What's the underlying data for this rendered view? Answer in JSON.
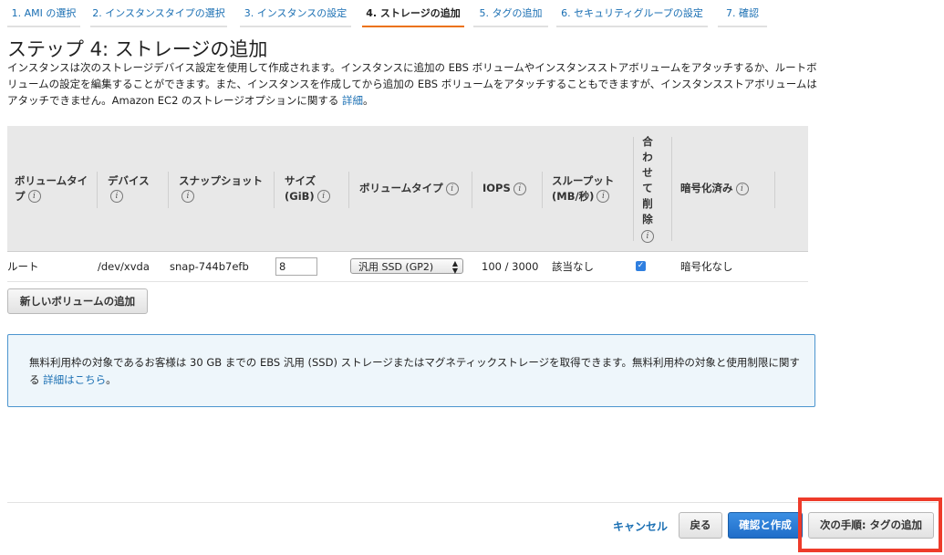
{
  "steps": [
    {
      "label": "1. AMI の選択"
    },
    {
      "label": "2. インスタンスタイプの選択"
    },
    {
      "label": "3. インスタンスの設定"
    },
    {
      "label": "4. ストレージの追加"
    },
    {
      "label": "5. タグの追加"
    },
    {
      "label": "6. セキュリティグループの設定"
    },
    {
      "label": "7. 確認"
    }
  ],
  "header": {
    "title": "ステップ 4: ストレージの追加",
    "description": "インスタンスは次のストレージデバイス設定を使用して作成されます。インスタンスに追加の EBS ボリュームやインスタンスストアボリュームをアタッチするか、ルートボリュームの設定を編集することができます。また、インスタンスを作成してから追加の EBS ボリュームをアタッチすることもできますが、インスタンスストアボリュームはアタッチできません。Amazon EC2 のストレージオプションに関する ",
    "details_link": "詳細",
    "description_end": "。"
  },
  "table": {
    "columns": {
      "volume_type": "ボリュームタイプ",
      "device": "デバイス",
      "snapshot": "スナップショット",
      "size": "サイズ (GiB)",
      "volume_kind": "ボリュームタイプ",
      "iops": "IOPS",
      "throughput": "スループット (MB/秒)",
      "delete": "合わせて削除",
      "encrypted": "暗号化済み"
    },
    "info_glyph": "i",
    "row": {
      "volume_type": "ルート",
      "device": "/dev/xvda",
      "snapshot": "snap-744b7efb",
      "size": "8",
      "volume_kind": "汎用 SSD (GP2)",
      "iops": "100 / 3000",
      "throughput": "該当なし",
      "delete_on_termination": true,
      "encrypted": "暗号化なし"
    }
  },
  "add_volume_button": "新しいボリュームの追加",
  "notice": {
    "text": "無料利用枠の対象であるお客様は 30 GB までの EBS 汎用 (SSD) ストレージまたはマグネティックストレージを取得できます。無料利用枠の対象と使用制限に関する ",
    "link": "詳細はこちら",
    "end": "。"
  },
  "footer": {
    "cancel": "キャンセル",
    "back": "戻る",
    "review_launch": "確認と作成",
    "next": "次の手順: タグの追加"
  },
  "colors": {
    "link": "#1a6fb3",
    "active_step_underline": "#ec7211",
    "primary_button": "#1f6dc9",
    "highlight": "#ee3b2a"
  }
}
